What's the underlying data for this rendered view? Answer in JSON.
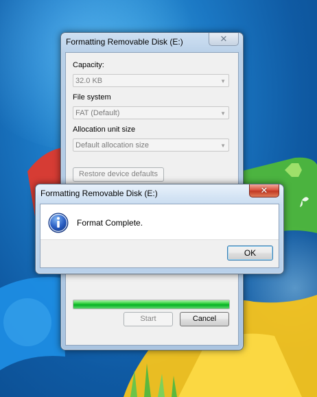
{
  "back_window": {
    "title": "Formatting Removable Disk (E:)",
    "close_glyph": "✕",
    "capacity_label": "Capacity:",
    "capacity_value": "32.0 KB",
    "filesystem_label": "File system",
    "filesystem_value": "FAT (Default)",
    "allocation_label": "Allocation unit size",
    "allocation_value": "Default allocation size",
    "restore_label": "Restore device defaults",
    "progress_fraction": 1.0,
    "start_label": "Start",
    "cancel_label": "Cancel"
  },
  "dialog": {
    "title": "Formatting Removable Disk (E:)",
    "close_glyph": "✕",
    "message": "Format Complete.",
    "icon": "info-icon",
    "ok_label": "OK"
  },
  "colors": {
    "progress_green": "#06b025",
    "desktop_blue": "#1b78c4"
  }
}
